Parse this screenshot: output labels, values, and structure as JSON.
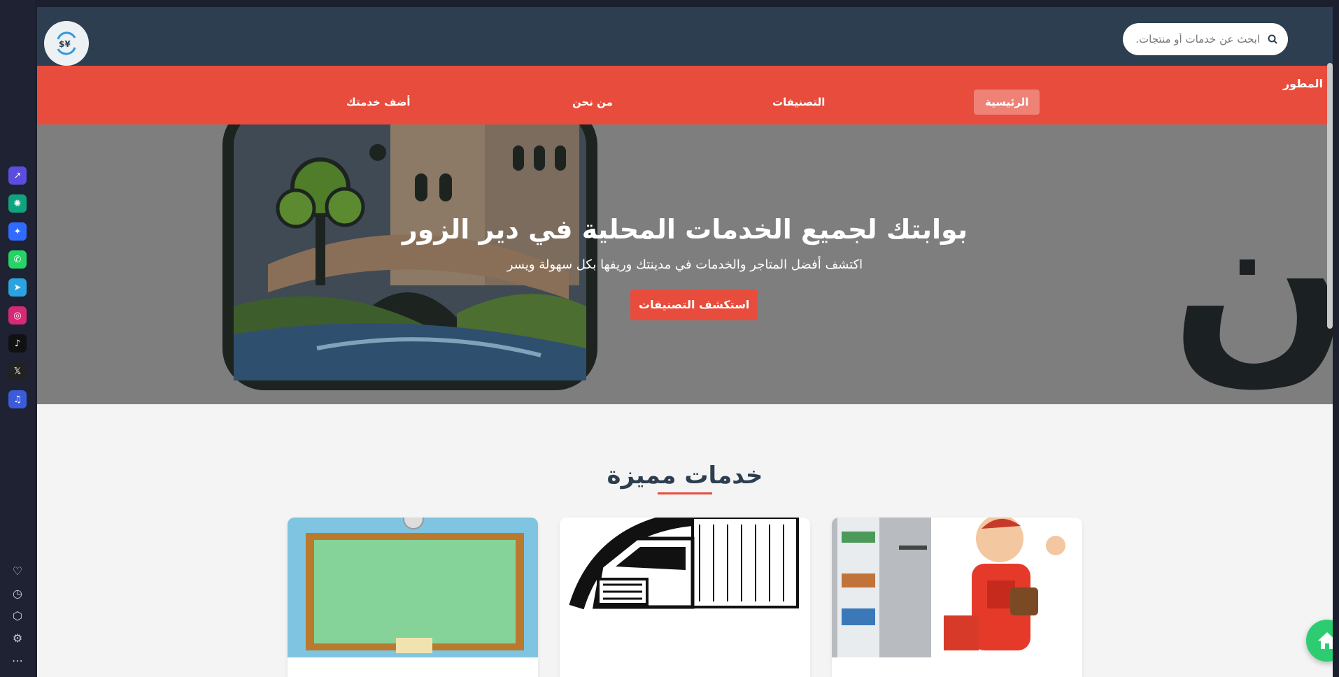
{
  "search": {
    "placeholder": "ابحث عن خدمات أو منتجات."
  },
  "logo": {
    "icon": "currency-exchange-icon",
    "glyph": "$¥"
  },
  "navbar": {
    "brand": "المطور",
    "items": [
      {
        "label": "الرئيسية",
        "active": true
      },
      {
        "label": "التصنيفات",
        "active": false
      },
      {
        "label": "من نحن",
        "active": false
      },
      {
        "label": "أضف خدمتك",
        "active": false
      }
    ]
  },
  "hero": {
    "title": "بوابتك لجميع الخدمات المحلية في دير الزور",
    "subtitle": "اكتشف أفضل المتاجر والخدمات في مدينتك وريفها بكل سهولة ويسر",
    "button": "استكشف التصنيفات",
    "background_wordmark": "امازون"
  },
  "featured": {
    "title": "خدمات مميزة",
    "cards": [
      {
        "image": "chalkboard"
      },
      {
        "image": "truck"
      },
      {
        "image": "repairman"
      }
    ]
  },
  "browser_sidebar": {
    "apps": [
      "arc-icon",
      "chatgpt-icon",
      "messenger-icon",
      "whatsapp-icon",
      "telegram-icon",
      "instagram-icon",
      "tiktok-icon",
      "x-icon",
      "music-icon"
    ],
    "bottom": [
      "heart-icon",
      "history-icon",
      "box-icon",
      "settings-icon",
      "more-icon"
    ]
  },
  "colors": {
    "topbar": "#2c3e50",
    "navbar": "#e74c3c",
    "fab": "#2ecc71"
  }
}
